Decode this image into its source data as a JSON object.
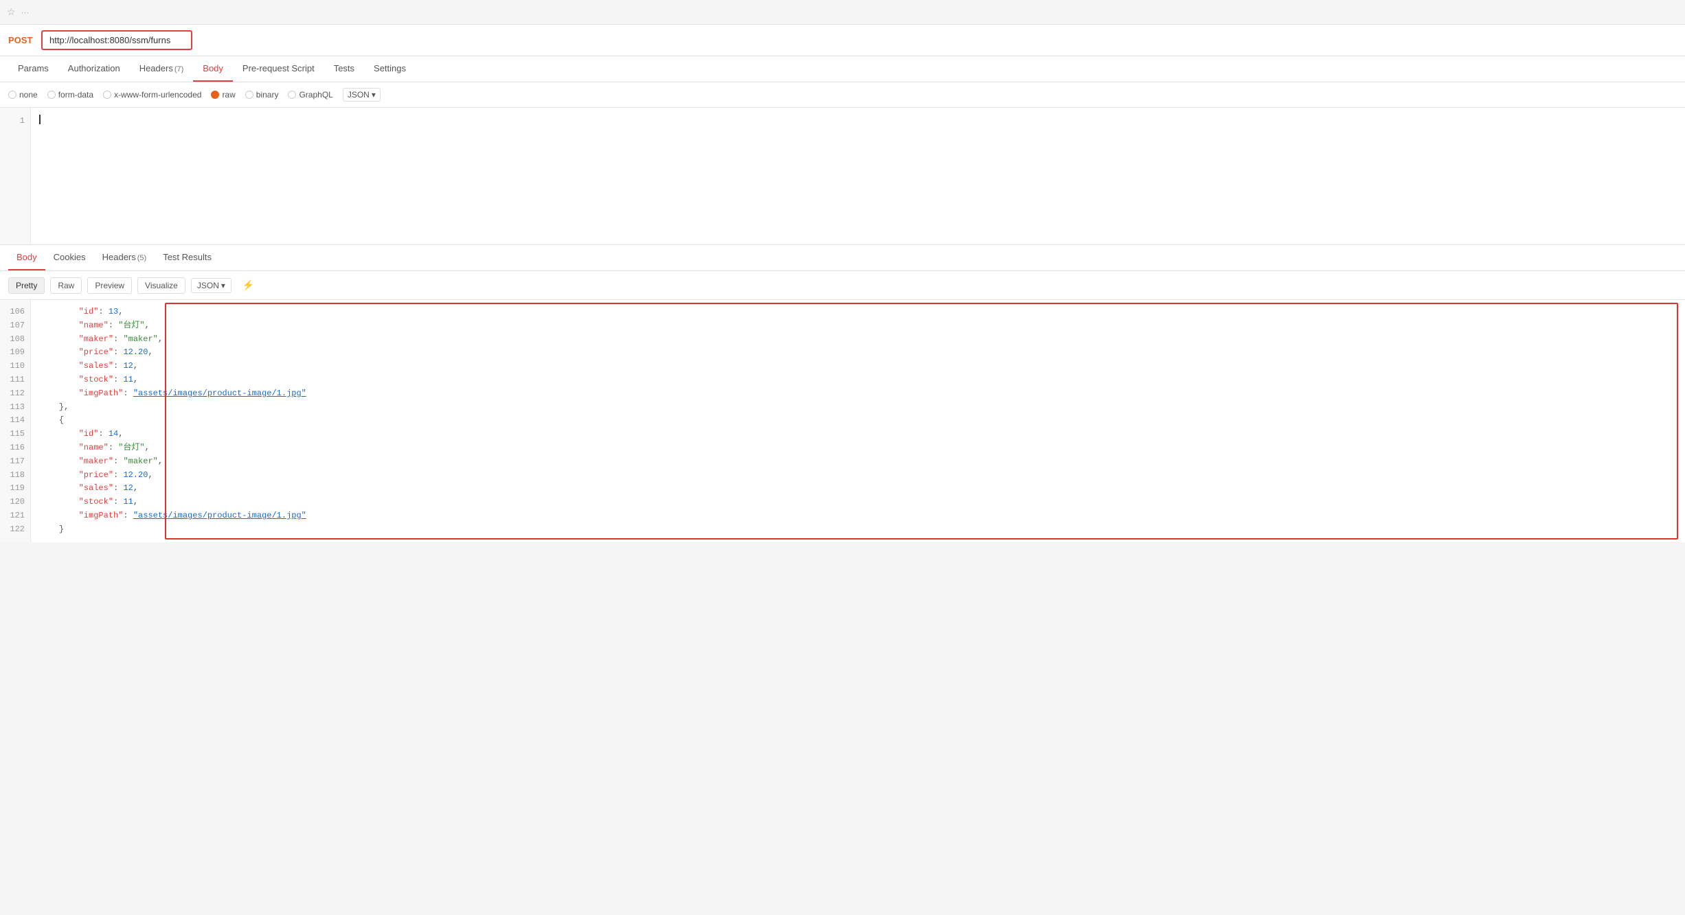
{
  "topbar": {
    "star_label": "☆",
    "more_label": "···"
  },
  "request": {
    "method": "POST",
    "url": "http://localhost:8080/ssm/furns"
  },
  "tabs": [
    {
      "id": "params",
      "label": "Params",
      "active": false
    },
    {
      "id": "authorization",
      "label": "Authorization",
      "active": false
    },
    {
      "id": "headers",
      "label": "Headers",
      "badge": "(7)",
      "active": false
    },
    {
      "id": "body",
      "label": "Body",
      "active": true
    },
    {
      "id": "pre-request-script",
      "label": "Pre-request Script",
      "active": false
    },
    {
      "id": "tests",
      "label": "Tests",
      "active": false
    },
    {
      "id": "settings",
      "label": "Settings",
      "active": false
    }
  ],
  "body_types": [
    {
      "id": "none",
      "label": "none",
      "active": false
    },
    {
      "id": "form-data",
      "label": "form-data",
      "active": false
    },
    {
      "id": "urlencoded",
      "label": "x-www-form-urlencoded",
      "active": false
    },
    {
      "id": "raw",
      "label": "raw",
      "active": true
    },
    {
      "id": "binary",
      "label": "binary",
      "active": false
    },
    {
      "id": "graphql",
      "label": "GraphQL",
      "active": false
    }
  ],
  "json_format": "JSON",
  "editor": {
    "line": 1
  },
  "response_tabs": [
    {
      "id": "body",
      "label": "Body",
      "active": true
    },
    {
      "id": "cookies",
      "label": "Cookies",
      "active": false
    },
    {
      "id": "headers",
      "label": "Headers",
      "badge": "(5)",
      "active": false
    },
    {
      "id": "test-results",
      "label": "Test Results",
      "active": false
    }
  ],
  "response_views": [
    "Pretty",
    "Raw",
    "Preview",
    "Visualize"
  ],
  "active_view": "Pretty",
  "response_format": "JSON",
  "json_lines": [
    {
      "num": 106,
      "indent": 1,
      "content": "\"id\": 13,",
      "key": "id",
      "value": "13",
      "type": "num"
    },
    {
      "num": 107,
      "indent": 1,
      "content": "\"name\": \"台灯\",",
      "key": "name",
      "value": "台灯",
      "type": "str"
    },
    {
      "num": 108,
      "indent": 1,
      "content": "\"maker\": \"maker\",",
      "key": "maker",
      "value": "maker",
      "type": "str"
    },
    {
      "num": 109,
      "indent": 1,
      "content": "\"price\": 12.20,",
      "key": "price",
      "value": "12.20",
      "type": "num"
    },
    {
      "num": 110,
      "indent": 1,
      "content": "\"sales\": 12,",
      "key": "sales",
      "value": "12",
      "type": "num"
    },
    {
      "num": 111,
      "indent": 1,
      "content": "\"stock\": 11,",
      "key": "stock",
      "value": "11",
      "type": "num"
    },
    {
      "num": 112,
      "indent": 1,
      "content": "\"imgPath\": \"assets/images/product-image/1.jpg\"",
      "key": "imgPath",
      "value": "assets/images/product-image/1.jpg",
      "type": "link"
    },
    {
      "num": 113,
      "indent": 0,
      "content": "},",
      "type": "brace"
    },
    {
      "num": 114,
      "indent": 0,
      "content": "{",
      "type": "brace"
    },
    {
      "num": 115,
      "indent": 1,
      "content": "\"id\": 14,",
      "key": "id",
      "value": "14",
      "type": "num"
    },
    {
      "num": 116,
      "indent": 1,
      "content": "\"name\": \"台灯\",",
      "key": "name",
      "value": "台灯",
      "type": "str"
    },
    {
      "num": 117,
      "indent": 1,
      "content": "\"maker\": \"maker\",",
      "key": "maker",
      "value": "maker",
      "type": "str"
    },
    {
      "num": 118,
      "indent": 1,
      "content": "\"price\": 12.20,",
      "key": "price",
      "value": "12.20",
      "type": "num"
    },
    {
      "num": 119,
      "indent": 1,
      "content": "\"sales\": 12,",
      "key": "sales",
      "value": "12",
      "type": "num"
    },
    {
      "num": 120,
      "indent": 1,
      "content": "\"stock\": 11,",
      "key": "stock",
      "value": "11",
      "type": "num"
    },
    {
      "num": 121,
      "indent": 1,
      "content": "\"imgPath\": \"assets/images/product-image/1.jpg\"",
      "key": "imgPath",
      "value": "assets/images/product-image/1.jpg",
      "type": "link"
    },
    {
      "num": 122,
      "indent": 0,
      "content": "}",
      "type": "brace"
    }
  ]
}
